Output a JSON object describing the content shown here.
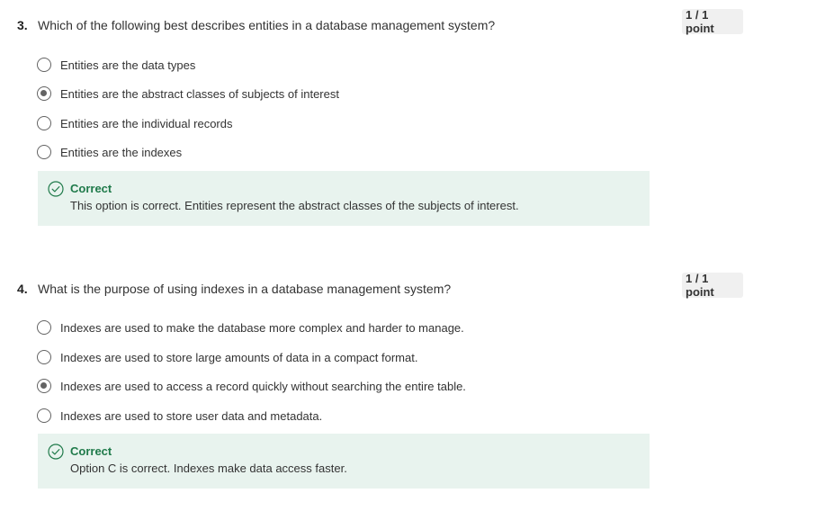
{
  "questions": [
    {
      "number": "3.",
      "text": "Which of the following best describes entities in a database management system?",
      "points": "1 / 1 point",
      "options": [
        {
          "label": "Entities are the data types",
          "selected": false
        },
        {
          "label": "Entities are the abstract classes of subjects of interest",
          "selected": true
        },
        {
          "label": "Entities are the individual records",
          "selected": false
        },
        {
          "label": "Entities are the indexes",
          "selected": false
        }
      ],
      "feedback": {
        "title": "Correct",
        "text": "This option is correct. Entities represent the abstract classes of the subjects of interest.",
        "icon": "check-circle-icon"
      }
    },
    {
      "number": "4.",
      "text": "What is the purpose of using indexes in a database management system?",
      "points": "1 / 1 point",
      "options": [
        {
          "label": "Indexes are used to make the database more complex and harder to manage.",
          "selected": false
        },
        {
          "label": "Indexes are used to store large amounts of data in a compact format.",
          "selected": false
        },
        {
          "label": "Indexes are used to access a record quickly without searching the entire table.",
          "selected": true
        },
        {
          "label": "Indexes are used to store user data and metadata.",
          "selected": false
        }
      ],
      "feedback": {
        "title": "Correct",
        "text": "Option C is correct. Indexes make data access faster.",
        "icon": "check-circle-icon"
      }
    }
  ],
  "colors": {
    "feedback_bg": "#e8f3ee",
    "correct_green": "#1f7a4a",
    "radio_gray": "#636363",
    "points_bg": "#f0f0f0"
  }
}
